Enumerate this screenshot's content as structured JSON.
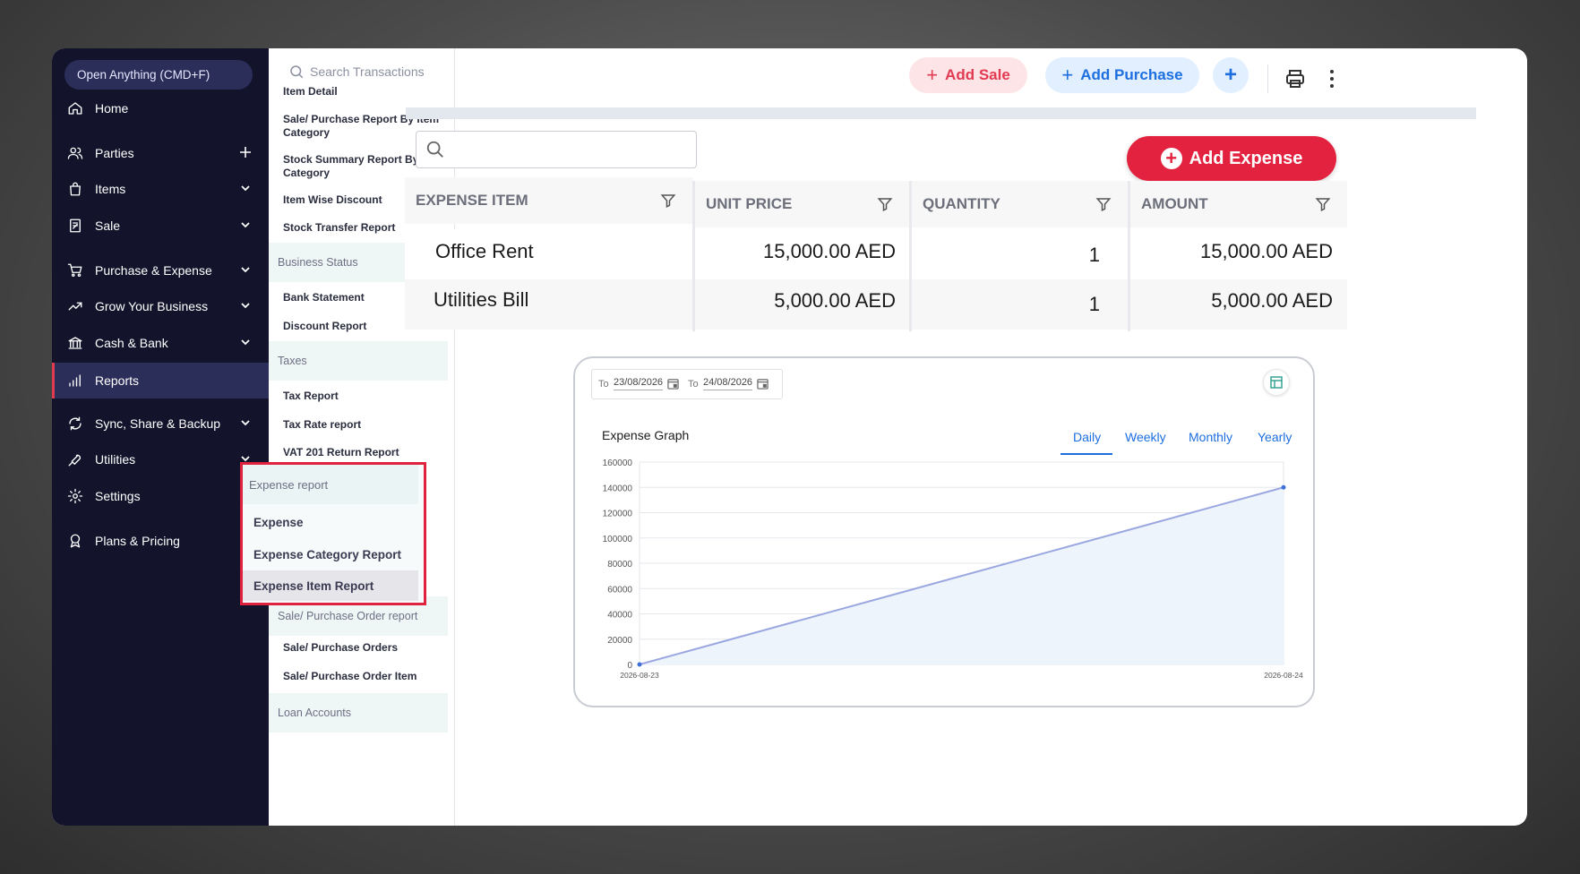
{
  "sidebar": {
    "open_anything": "Open Anything (CMD+F)",
    "items": [
      {
        "label": "Home",
        "icon": "home-icon"
      },
      {
        "label": "Parties",
        "icon": "users-icon",
        "trail": "plus"
      },
      {
        "label": "Items",
        "icon": "bag-icon",
        "trail": "chevron"
      },
      {
        "label": "Sale",
        "icon": "receipt-icon",
        "trail": "chevron"
      },
      {
        "label": "Purchase & Expense",
        "icon": "cart-icon",
        "trail": "chevron"
      },
      {
        "label": "Grow Your Business",
        "icon": "trend-icon",
        "trail": "chevron"
      },
      {
        "label": "Cash & Bank",
        "icon": "bank-icon",
        "trail": "chevron"
      },
      {
        "label": "Reports",
        "icon": "bar-chart-icon",
        "active": true
      },
      {
        "label": "Sync, Share & Backup",
        "icon": "sync-icon",
        "trail": "chevron"
      },
      {
        "label": "Utilities",
        "icon": "tools-icon",
        "trail": "chevron"
      },
      {
        "label": "Settings",
        "icon": "gear-icon"
      },
      {
        "label": "Plans & Pricing",
        "icon": "badge-icon"
      }
    ]
  },
  "reports": {
    "search_placeholder": "Search Transactions",
    "items": {
      "item_detail": "Item Detail",
      "sale_purchase_by_category": "Sale/ Purchase Report By Item Category",
      "stock_summary_by_category": "Stock Summary Report By Item Category",
      "item_wise_discount": "Item Wise Discount",
      "stock_transfer": "Stock Transfer Report",
      "business_status": "Business Status",
      "bank_statement": "Bank Statement",
      "discount_report": "Discount Report",
      "taxes": "Taxes",
      "tax_report": "Tax Report",
      "tax_rate_report": "Tax Rate report",
      "vat_201": "VAT 201 Return Report",
      "expense_report": "Expense report",
      "expense": "Expense",
      "expense_category_report": "Expense Category Report",
      "expense_item_report": "Expense Item Report",
      "sale_purchase_order_report": "Sale/ Purchase Order report",
      "sale_purchase_orders": "Sale/ Purchase Orders",
      "sale_purchase_order_item": "Sale/ Purchase Order Item",
      "loan_accounts": "Loan Accounts"
    }
  },
  "topbar": {
    "add_sale": "Add Sale",
    "add_purchase": "Add Purchase",
    "plus": "+"
  },
  "main": {
    "add_expense": "Add Expense",
    "table": {
      "headers": [
        "EXPENSE ITEM",
        "UNIT PRICE",
        "QUANTITY",
        "AMOUNT"
      ],
      "rows": [
        [
          "Office Rent",
          "15,000.00 AED",
          "1",
          "15,000.00 AED"
        ],
        [
          "Utilities Bill",
          "5,000.00 AED",
          "1",
          "5,000.00 AED"
        ]
      ]
    },
    "chart_panel": {
      "from_label": "To",
      "from_date": "23/08/2026",
      "to_label": "To",
      "to_date": "24/08/2026",
      "title": "Expense Graph",
      "ranges": [
        "Daily",
        "Weekly",
        "Monthly",
        "Yearly"
      ],
      "selected_range": "Daily"
    }
  },
  "colors": {
    "accent_red": "#e2223f",
    "accent_blue": "#1d6fe0",
    "sidebar_bg": "#13142b",
    "line": "#9aa7e0"
  },
  "chart_data": {
    "type": "area",
    "title": "Expense Graph",
    "x": [
      "2026-08-23",
      "2026-08-24"
    ],
    "values": [
      0,
      140000
    ],
    "y_ticks": [
      "0",
      "20000",
      "40000",
      "60000",
      "80000",
      "100000",
      "120000",
      "140000",
      "160000"
    ],
    "ylim": [
      0,
      160000
    ],
    "grid": true,
    "xlabel": "",
    "ylabel": ""
  }
}
